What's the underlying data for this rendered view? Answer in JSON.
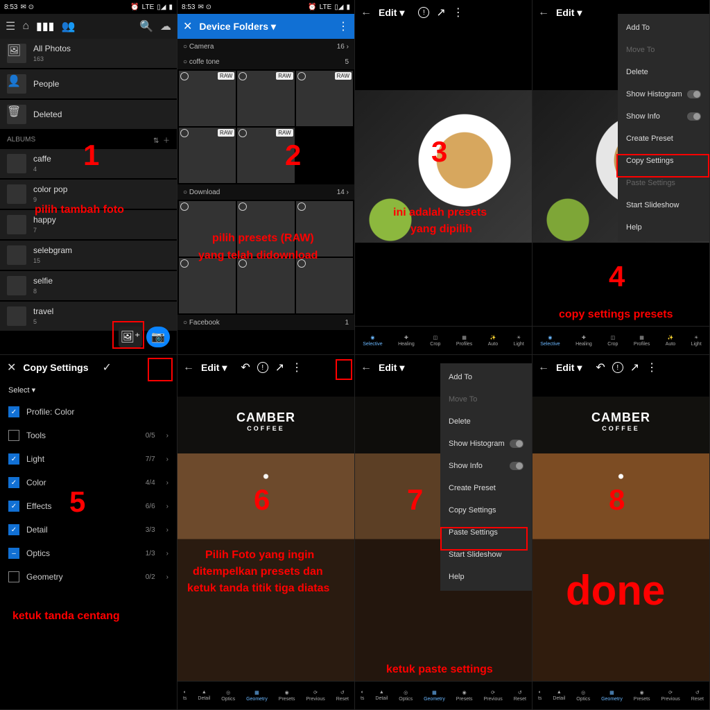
{
  "status": {
    "time": "8:53",
    "signal": "LTE",
    "wifi": "◒",
    "bat": "▮"
  },
  "p1": {
    "allphotos": {
      "label": "All Photos",
      "count": "163"
    },
    "people": {
      "label": "People"
    },
    "deleted": {
      "label": "Deleted"
    },
    "albums_hdr": "ALBUMS",
    "albums": [
      {
        "label": "caffe",
        "count": "4"
      },
      {
        "label": "color pop",
        "count": "9"
      },
      {
        "label": "happy",
        "count": "7"
      },
      {
        "label": "selebgram",
        "count": "15"
      },
      {
        "label": "selfie",
        "count": "8"
      },
      {
        "label": "travel",
        "count": "5"
      }
    ],
    "num": "1",
    "anno": "pilih tambah foto"
  },
  "p2": {
    "title": "Device Folders ▾",
    "folders": [
      {
        "name": "Camera",
        "count": "16",
        "chev": "›"
      },
      {
        "name": "coffe tone",
        "count": "5"
      },
      {
        "name": "Download",
        "count": "14",
        "chev": "›"
      },
      {
        "name": "Facebook",
        "count": "1"
      }
    ],
    "raw": "RAW",
    "num": "2",
    "anno1": "pilih presets (RAW)",
    "anno2": "yang telah didownload"
  },
  "p3": {
    "title": "Edit ▾",
    "num": "3",
    "anno1": "ini adalah presets",
    "anno2": "yang dipilih",
    "tools": [
      "Selective",
      "Healing",
      "Crop",
      "Profiles",
      "Auto",
      "Light"
    ]
  },
  "p4": {
    "title": "Edit ▾",
    "menu": [
      "Add To",
      "Move To",
      "Delete",
      "Show Histogram",
      "Show Info",
      "Create Preset",
      "Copy Settings",
      "Paste Settings",
      "Start Slideshow",
      "Help"
    ],
    "num": "4",
    "anno": "copy settings presets"
  },
  "p5": {
    "title": "Copy Settings",
    "select": "Select ▾",
    "rows": [
      {
        "name": "Profile: Color",
        "on": true
      },
      {
        "name": "Tools",
        "ct": "0/5"
      },
      {
        "name": "Light",
        "on": true,
        "ct": "7/7"
      },
      {
        "name": "Color",
        "on": true,
        "ct": "4/4"
      },
      {
        "name": "Effects",
        "on": true,
        "ct": "6/6"
      },
      {
        "name": "Detail",
        "on": true,
        "ct": "3/3"
      },
      {
        "name": "Optics",
        "half": true,
        "ct": "1/3"
      },
      {
        "name": "Geometry",
        "ct": "0/2"
      }
    ],
    "num": "5",
    "anno": "ketuk tanda centang"
  },
  "p6": {
    "title": "Edit ▾",
    "logo": "CAMBER",
    "logo_sub": "COFFEE",
    "num": "6",
    "anno1": "Pilih Foto yang ingin",
    "anno2": "ditempelkan presets dan",
    "anno3": "ketuk tanda titik tiga diatas",
    "tools": [
      "ts",
      "Detail",
      "Optics",
      "Geometry",
      "Presets",
      "Previous",
      "Reset"
    ]
  },
  "p7": {
    "title": "Edit ▾",
    "menu": [
      "Add To",
      "Move To",
      "Delete",
      "Show Histogram",
      "Show Info",
      "Create Preset",
      "Copy Settings",
      "Paste Settings",
      "Start Slideshow",
      "Help"
    ],
    "num": "7",
    "anno": "ketuk paste settings"
  },
  "p8": {
    "title": "Edit ▾",
    "num": "8",
    "anno": "done"
  }
}
